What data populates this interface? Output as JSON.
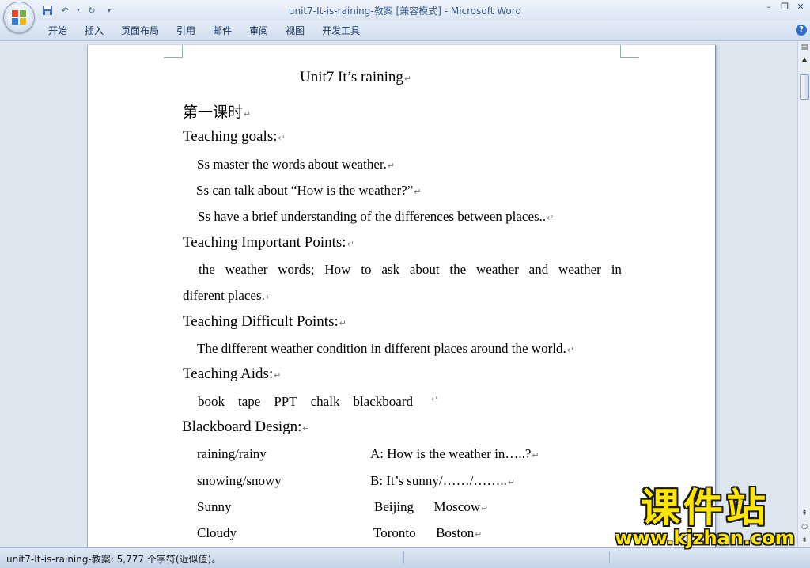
{
  "window": {
    "title": "unit7-It-is-raining-教案 [兼容模式]",
    "title_sep": " - ",
    "app_name": "Microsoft Word"
  },
  "ribbon": {
    "tabs": [
      "开始",
      "插入",
      "页面布局",
      "引用",
      "邮件",
      "审阅",
      "视图",
      "开发工具"
    ]
  },
  "document": {
    "title": "Unit7 It’s raining",
    "lesson": "第一课时",
    "goals_heading": "Teaching goals:",
    "goals": [
      "Ss master the words about weather.",
      "Ss can talk about “How is the weather?”",
      "Ss have a brief understanding of the differences between places.."
    ],
    "important_heading": "Teaching Important Points:",
    "important_line1": [
      "the",
      "weather",
      "words;",
      "How",
      "to",
      "ask",
      "about",
      "the",
      "weather",
      "and",
      "weather",
      "in"
    ],
    "important_line2": "diferent places.",
    "difficult_heading": "Teaching Difficult Points:",
    "difficult_text": "The different weather condition in different places around the world.",
    "aids_heading": "Teaching Aids:",
    "aids": [
      "book",
      "tape",
      "PPT",
      "chalk",
      "blackboard"
    ],
    "design_heading": "Blackboard Design:",
    "design_rows": [
      {
        "left": "raining/rainy",
        "right": "A: How is the weather in…..?"
      },
      {
        "left": "snowing/snowy",
        "right": "B: It’s sunny/……/…….."
      },
      {
        "left": "Sunny",
        "right": "Beijing      Moscow"
      },
      {
        "left": "Cloudy",
        "right": "Toronto      Boston"
      }
    ],
    "paragraph_mark": "↵"
  },
  "status_bar": {
    "text": "unit7-It-is-raining-教案: 5,777 个字符(近似值)。"
  },
  "watermark": {
    "cn": "课件站",
    "url": "www.kjzhan.com"
  }
}
